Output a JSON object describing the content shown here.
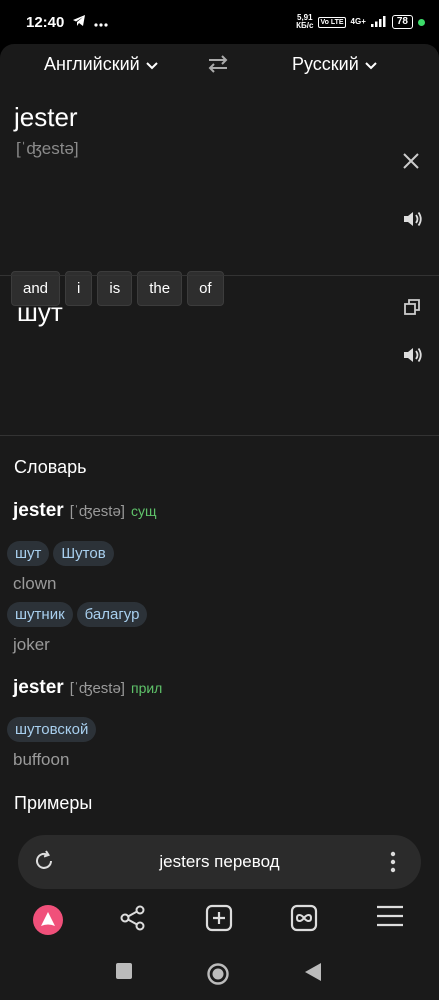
{
  "status": {
    "time": "12:40",
    "net_speed_top": "5,91",
    "net_speed_bottom": "КБ/с",
    "volte": "Vo LTE",
    "signal": "4G+",
    "battery": "78"
  },
  "lang_bar": {
    "source_lang": "Английский",
    "target_lang": "Русский"
  },
  "input": {
    "word": "jester",
    "transcription": "[ˈʤestə]",
    "suggestions": [
      "and",
      "i",
      "is",
      "the",
      "of"
    ]
  },
  "result": {
    "translation": "шут"
  },
  "dictionary": {
    "title": "Словарь",
    "entries": [
      {
        "word": "jester",
        "transcription": "[ˈʤestə]",
        "pos": "сущ",
        "groups": [
          {
            "translations": [
              "шут",
              "Шутов"
            ],
            "synonym": "clown"
          },
          {
            "translations": [
              "шутник",
              "балагур"
            ],
            "synonym": "joker"
          }
        ]
      },
      {
        "word": "jester",
        "transcription": "[ˈʤestə]",
        "pos": "прил",
        "groups": [
          {
            "translations": [
              "шутовской"
            ],
            "synonym": "buffoon"
          }
        ]
      }
    ],
    "examples_title": "Примеры"
  },
  "search": {
    "query": "jesters перевод"
  },
  "colors": {
    "accent_alice": "#f0507a",
    "pos_green": "#5fc36a",
    "chip_text": "#a8cfee"
  },
  "icons": {
    "telegram": "telegram-icon",
    "swap": "swap-icon",
    "close": "close-icon",
    "speaker": "speaker-icon",
    "copy": "copy-icon",
    "reload": "reload-icon",
    "more": "more-vertical-icon",
    "alice": "alice-icon",
    "share": "share-icon",
    "add_tab": "add-tab-icon",
    "tabs": "tabs-icon",
    "menu": "menu-icon"
  }
}
